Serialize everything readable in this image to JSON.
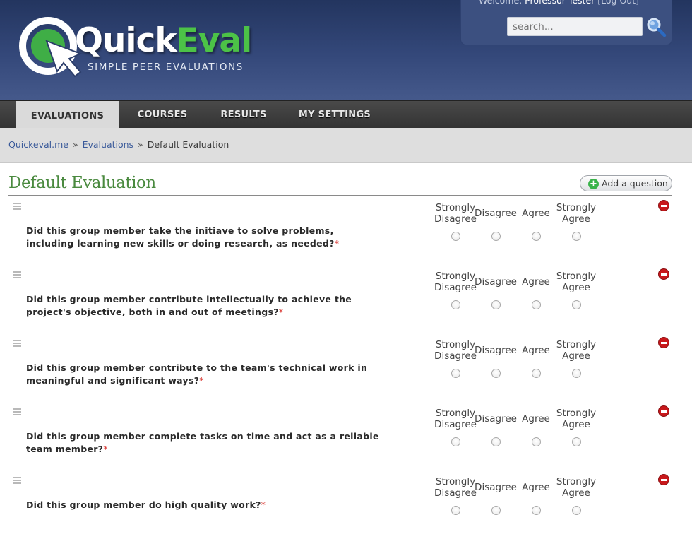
{
  "header": {
    "logo_quick": "Quick",
    "logo_eval": "Eval",
    "tagline": "SIMPLE PEER EVALUATIONS",
    "welcome_prefix": "Welcome,",
    "user_name": "Professor Tester",
    "logout": "[Log Out]",
    "search_placeholder": "search...",
    "search_icon": "magnifier-icon"
  },
  "nav": {
    "items": [
      {
        "label": "EVALUATIONS",
        "active": true
      },
      {
        "label": "COURSES",
        "active": false
      },
      {
        "label": "RESULTS",
        "active": false
      },
      {
        "label": "MY SETTINGS",
        "active": false
      }
    ]
  },
  "breadcrumb": {
    "items": [
      "Quickeval.me",
      "Evaluations",
      "Default Evaluation"
    ],
    "separator": "»"
  },
  "page": {
    "title": "Default Evaluation",
    "add_question_label": "Add a question"
  },
  "scale": {
    "options": [
      "Strongly Disagree",
      "Disagree",
      "Agree",
      "Strongly Agree"
    ]
  },
  "questions": [
    {
      "text": "Did this group member take the initiave to solve problems, including learning new skills or doing research, as needed?",
      "required_mark": "*"
    },
    {
      "text": "Did this group member contribute intellectually to achieve the project's objective, both in and out of meetings?",
      "required_mark": "*"
    },
    {
      "text": "Did this group member contribute to the team's technical work in meaningful and significant ways?",
      "required_mark": "*"
    },
    {
      "text": "Did this group member complete tasks on time and act as a reliable team member?",
      "required_mark": "*"
    },
    {
      "text": "Did this group member do high quality work?",
      "required_mark": "*"
    }
  ],
  "colors": {
    "brand_green": "#4cc247",
    "title_green": "#4a8a3f",
    "header_blue": "#34487a",
    "remove_red": "#c8181b"
  }
}
